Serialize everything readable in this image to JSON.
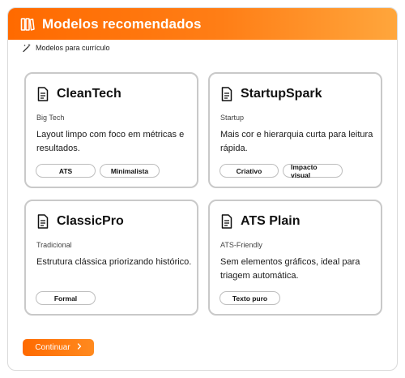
{
  "header": {
    "title": "Modelos recomendados",
    "icon": "books-icon"
  },
  "subheader": {
    "label": "Modelos para currículo",
    "icon": "magic-wand-icon"
  },
  "cards": [
    {
      "title": "CleanTech",
      "category": "Big Tech",
      "description": "Layout limpo com foco em métricas e resultados.",
      "tags": [
        "ATS",
        "Minimalista"
      ]
    },
    {
      "title": "StartupSpark",
      "category": "Startup",
      "description": "Mais cor e hierarquia curta para leitura rápida.",
      "tags": [
        "Criativo",
        "Impacto visual"
      ]
    },
    {
      "title": "ClassicPro",
      "category": "Tradicional",
      "description": "Estrutura clássica priorizando histórico.",
      "tags": [
        "Formal"
      ]
    },
    {
      "title": "ATS Plain",
      "category": "ATS-Friendly",
      "description": "Sem elementos gráficos, ideal para triagem automática.",
      "tags": [
        "Texto puro"
      ]
    }
  ],
  "actions": {
    "continue_label": "Continuar",
    "continue_icon": "chevron-right-icon"
  },
  "colors": {
    "accent": "#ff6a00",
    "accent_end": "#ffa63c",
    "card_border": "#c9c9c9"
  }
}
